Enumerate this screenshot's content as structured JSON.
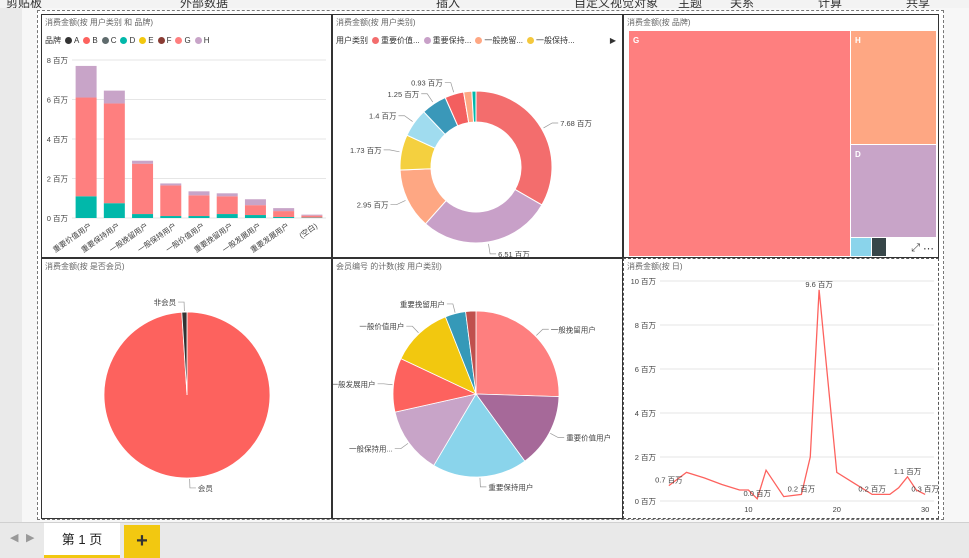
{
  "ribbon": {
    "items": [
      "剪贴板",
      "外部数据",
      "插入",
      "自定义视觉对象",
      "主题",
      "关系",
      "计算",
      "共享"
    ]
  },
  "visuals": {
    "bar": {
      "title": "消费金额(按 用户类别 和 品牌)",
      "legend_label": "品牌",
      "legend": [
        {
          "name": "A",
          "color": "#333333"
        },
        {
          "name": "B",
          "color": "#fd625e"
        },
        {
          "name": "C",
          "color": "#5f6b6d"
        },
        {
          "name": "D",
          "color": "#01b8aa"
        },
        {
          "name": "E",
          "color": "#f2c80f"
        },
        {
          "name": "F",
          "color": "#8a3c34"
        },
        {
          "name": "G",
          "color": "#fe7f7f"
        },
        {
          "name": "H",
          "color": "#c8a4c8"
        }
      ]
    },
    "donut": {
      "title": "消费金额(按 用户类别)",
      "legend_label": "用户类别",
      "legend": [
        {
          "name": "重要价值...",
          "color": "#f36d6d"
        },
        {
          "name": "重要保持...",
          "color": "#c8a0c8"
        },
        {
          "name": "一般挽留...",
          "color": "#fea783"
        },
        {
          "name": "一般保持...",
          "color": "#f4c83c"
        }
      ]
    },
    "treemap": {
      "title": "消费金额(按 品牌)",
      "labels": [
        "G",
        "H",
        "D"
      ]
    },
    "pie_member": {
      "title": "消费金额(按 是否会员)"
    },
    "pie_count": {
      "title": "会员编号 的计数(按 用户类别)"
    },
    "line": {
      "title": "消费金额(按 日)"
    }
  },
  "chart_data": [
    {
      "type": "bar",
      "title": "消费金额(按 用户类别 和 品牌)",
      "categories": [
        "重要价值用户",
        "重要保持用户",
        "一般挽留用户",
        "一般保持用户",
        "一般价值用户",
        "重要挽留用户",
        "一般发展用户",
        "重要发展用户",
        "(空白)"
      ],
      "series": [
        {
          "name": "D",
          "color": "#01b8aa",
          "values": [
            1.1,
            0.75,
            0.2,
            0.1,
            0.1,
            0.2,
            0.15,
            0.05,
            0.02
          ]
        },
        {
          "name": "G",
          "color": "#fe7f7f",
          "values": [
            5.0,
            5.05,
            2.55,
            1.55,
            1.05,
            0.9,
            0.5,
            0.3,
            0.1
          ]
        },
        {
          "name": "H",
          "color": "#c8a4c8",
          "values": [
            1.6,
            0.65,
            0.15,
            0.1,
            0.2,
            0.15,
            0.3,
            0.15,
            0.05
          ]
        }
      ],
      "yticks": [
        "0 百万",
        "2 百万",
        "4 百万",
        "6 百万",
        "8 百万"
      ],
      "ylim": [
        0,
        8
      ]
    },
    {
      "type": "pie",
      "title": "消费金额(按 用户类别)",
      "slices": [
        {
          "label": "7.68 百万",
          "value": 7.68,
          "color": "#f36d6d"
        },
        {
          "label": "6.51 百万",
          "value": 6.51,
          "color": "#c8a0c8"
        },
        {
          "label": "2.95 百万",
          "value": 2.95,
          "color": "#fea783"
        },
        {
          "label": "1.73 百万",
          "value": 1.73,
          "color": "#f4d03f"
        },
        {
          "label": "1.4 百万",
          "value": 1.4,
          "color": "#a0dcef"
        },
        {
          "label": "1.25 百万",
          "value": 1.25,
          "color": "#3a98b9"
        },
        {
          "label": "0.93 百万",
          "value": 0.93,
          "color": "#f35f5f"
        },
        {
          "label": "",
          "value": 0.4,
          "color": "#fea783"
        },
        {
          "label": "",
          "value": 0.2,
          "color": "#01b8aa"
        }
      ]
    },
    {
      "type": "pie",
      "title": "消费金额(按 是否会员)",
      "slices": [
        {
          "label": "会员",
          "value": 0.99,
          "color": "#fd625e"
        },
        {
          "label": "非会员",
          "value": 0.01,
          "color": "#333333"
        }
      ]
    },
    {
      "type": "pie",
      "title": "会员编号 的计数(按 用户类别)",
      "slices": [
        {
          "label": "一般挽留用户",
          "value": 0.255,
          "color": "#fe7f7f"
        },
        {
          "label": "重要价值用户",
          "value": 0.145,
          "color": "#a66999"
        },
        {
          "label": "重要保持用户",
          "value": 0.185,
          "color": "#8ad4eb"
        },
        {
          "label": "一般保持用...",
          "value": 0.13,
          "color": "#c8a4c8"
        },
        {
          "label": "一般发展用户",
          "value": 0.105,
          "color": "#fd625e"
        },
        {
          "label": "一般价值用户",
          "value": 0.12,
          "color": "#f2c80f"
        },
        {
          "label": "重要挽留用户",
          "value": 0.04,
          "color": "#3599b8"
        },
        {
          "label": "",
          "value": 0.02,
          "color": "#c0504d"
        }
      ]
    },
    {
      "type": "line",
      "title": "消费金额(按 日)",
      "x": [
        1,
        3,
        5,
        7,
        9,
        10,
        11,
        12,
        14,
        16,
        17,
        18,
        20,
        22,
        24,
        26,
        27,
        28,
        29,
        30
      ],
      "y": [
        0.7,
        1.3,
        1.05,
        0.75,
        0.5,
        0.5,
        0.1,
        1.4,
        0.2,
        0.3,
        2.0,
        9.6,
        1.3,
        0.8,
        0.3,
        0.3,
        0.6,
        1.1,
        0.5,
        0.3
      ],
      "labels": [
        {
          "x": 1,
          "y": 0.7,
          "text": "0.7 百万"
        },
        {
          "x": 11,
          "y": 0.1,
          "text": "0.0 百万"
        },
        {
          "x": 16,
          "y": 0.3,
          "text": "0.2 百万"
        },
        {
          "x": 18,
          "y": 9.6,
          "text": "9.6 百万"
        },
        {
          "x": 24,
          "y": 0.3,
          "text": "0.2 百万"
        },
        {
          "x": 28,
          "y": 1.1,
          "text": "1.1 百万"
        },
        {
          "x": 30,
          "y": 0.3,
          "text": "0.3 百万"
        }
      ],
      "xticks": [
        "10",
        "20",
        "30"
      ],
      "yticks": [
        "0 百万",
        "2 百万",
        "4 百万",
        "6 百万",
        "8 百万",
        "10 百万"
      ],
      "ylim": [
        0,
        10
      ]
    }
  ],
  "tabs": {
    "page1": "第 1 页",
    "add": "+"
  }
}
